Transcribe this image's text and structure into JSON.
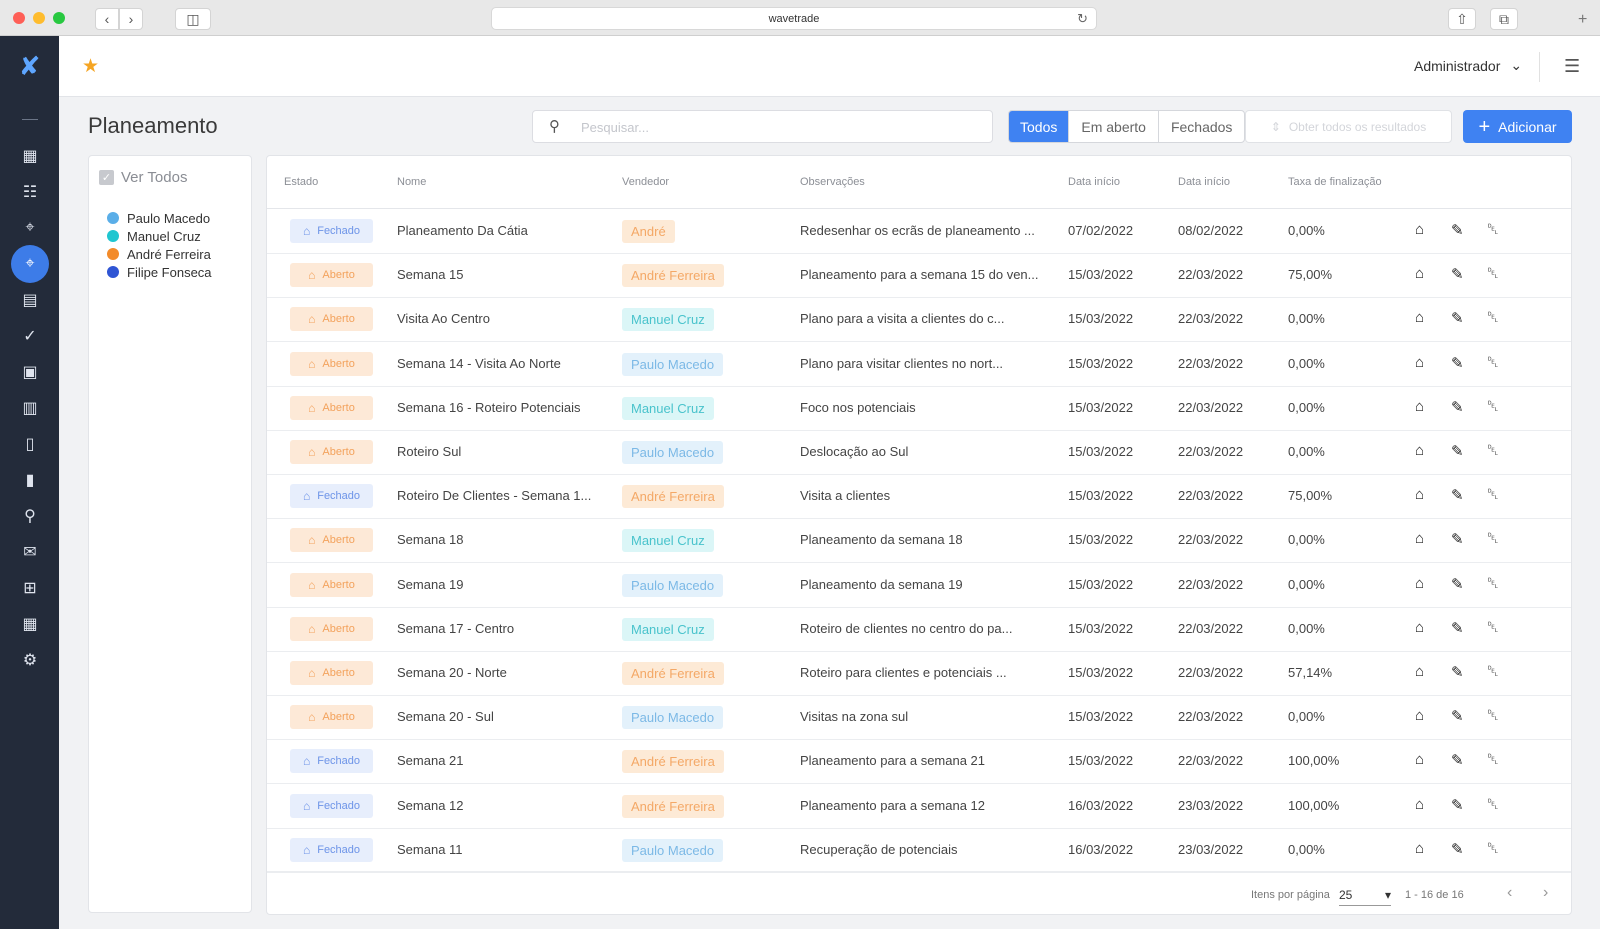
{
  "browser": {
    "url": "wavetrade"
  },
  "header": {
    "user": "Administrador"
  },
  "page": {
    "title": "Planeamento"
  },
  "search": {
    "placeholder": "Pesquisar..."
  },
  "filters": {
    "all": "Todos",
    "open": "Em aberto",
    "closed": "Fechados"
  },
  "toolbar": {
    "fetch_all": "Obter todos os resultados",
    "add": "Adicionar"
  },
  "sidebar_filter": {
    "all_label": "Ver Todos",
    "sellers": [
      {
        "name": "Paulo Macedo",
        "color": "#5aaee8"
      },
      {
        "name": "Manuel Cruz",
        "color": "#1fc6d0"
      },
      {
        "name": "André Ferreira",
        "color": "#f38b2a"
      },
      {
        "name": "Filipe Fonseca",
        "color": "#2f55d4"
      }
    ]
  },
  "table": {
    "columns": [
      "Estado",
      "Nome",
      "Vendedor",
      "Observações",
      "Data início",
      "Data início",
      "Taxa de finalização"
    ],
    "rows": [
      {
        "state": "Fechado",
        "name": "Planeamento Da Cátia",
        "seller": "André",
        "notes": "Redesenhar os ecrãs de planeamento ...",
        "start": "07/02/2022",
        "end": "08/02/2022",
        "rate": "0,00%"
      },
      {
        "state": "Aberto",
        "name": "Semana 15",
        "seller": "André Ferreira",
        "notes": "Planeamento para a semana 15 do ven...",
        "start": "15/03/2022",
        "end": "22/03/2022",
        "rate": "75,00%"
      },
      {
        "state": "Aberto",
        "name": "Visita Ao Centro",
        "seller": "Manuel Cruz",
        "notes": "Plano para a visita a clientes do c...",
        "start": "15/03/2022",
        "end": "22/03/2022",
        "rate": "0,00%"
      },
      {
        "state": "Aberto",
        "name": "Semana 14 - Visita Ao Norte",
        "seller": "Paulo Macedo",
        "notes": "Plano para visitar clientes no nort...",
        "start": "15/03/2022",
        "end": "22/03/2022",
        "rate": "0,00%"
      },
      {
        "state": "Aberto",
        "name": "Semana 16 - Roteiro Potenciais",
        "seller": "Manuel Cruz",
        "notes": "Foco nos potenciais",
        "start": "15/03/2022",
        "end": "22/03/2022",
        "rate": "0,00%"
      },
      {
        "state": "Aberto",
        "name": "Roteiro Sul",
        "seller": "Paulo Macedo",
        "notes": "Deslocação ao Sul",
        "start": "15/03/2022",
        "end": "22/03/2022",
        "rate": "0,00%"
      },
      {
        "state": "Fechado",
        "name": "Roteiro De Clientes - Semana 1...",
        "seller": "André Ferreira",
        "notes": "Visita a clientes",
        "start": "15/03/2022",
        "end": "22/03/2022",
        "rate": "75,00%"
      },
      {
        "state": "Aberto",
        "name": "Semana 18",
        "seller": "Manuel Cruz",
        "notes": "Planeamento da semana 18",
        "start": "15/03/2022",
        "end": "22/03/2022",
        "rate": "0,00%"
      },
      {
        "state": "Aberto",
        "name": "Semana 19",
        "seller": "Paulo Macedo",
        "notes": "Planeamento da semana 19",
        "start": "15/03/2022",
        "end": "22/03/2022",
        "rate": "0,00%"
      },
      {
        "state": "Aberto",
        "name": "Semana 17 - Centro",
        "seller": "Manuel Cruz",
        "notes": "Roteiro de clientes no centro do pa...",
        "start": "15/03/2022",
        "end": "22/03/2022",
        "rate": "0,00%"
      },
      {
        "state": "Aberto",
        "name": "Semana 20 - Norte",
        "seller": "André Ferreira",
        "notes": "Roteiro para clientes e potenciais ...",
        "start": "15/03/2022",
        "end": "22/03/2022",
        "rate": "57,14%"
      },
      {
        "state": "Aberto",
        "name": "Semana 20 - Sul",
        "seller": "Paulo Macedo",
        "notes": "Visitas na zona sul",
        "start": "15/03/2022",
        "end": "22/03/2022",
        "rate": "0,00%"
      },
      {
        "state": "Fechado",
        "name": "Semana 21",
        "seller": "André Ferreira",
        "notes": "Planeamento para a semana 21",
        "start": "15/03/2022",
        "end": "22/03/2022",
        "rate": "100,00%"
      },
      {
        "state": "Fechado",
        "name": "Semana 12",
        "seller": "André Ferreira",
        "notes": "Planeamento para a semana 12",
        "start": "16/03/2022",
        "end": "23/03/2022",
        "rate": "100,00%"
      },
      {
        "state": "Fechado",
        "name": "Semana 11",
        "seller": "Paulo Macedo",
        "notes": "Recuperação de potenciais",
        "start": "16/03/2022",
        "end": "23/03/2022",
        "rate": "0,00%"
      }
    ]
  },
  "pagination": {
    "label": "Itens por página",
    "per_page": "25",
    "range": "1 - 16 de 16"
  },
  "nav_icons": [
    "dashboard-icon",
    "contacts-card-icon",
    "location-pin-icon",
    "planning-pin-icon",
    "calendar-icon",
    "double-check-icon",
    "briefcase-icon",
    "contact-book-icon",
    "document-icon",
    "phone-route-icon",
    "search-icon",
    "mail-icon",
    "add-report-icon",
    "table-icon",
    "settings-icon"
  ]
}
